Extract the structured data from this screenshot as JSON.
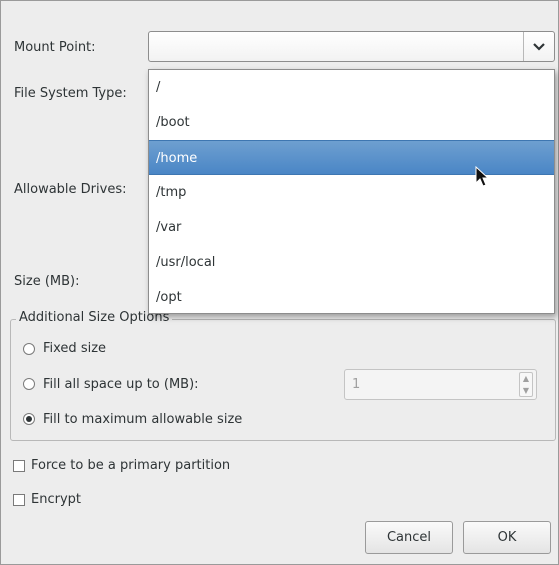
{
  "form": {
    "mount_point_label": "Mount Point:",
    "mount_point_value": "",
    "fs_type_label": "File System Type:",
    "allowable_drives_label": "Allowable Drives:",
    "size_label": "Size (MB):"
  },
  "mount_dropdown": {
    "items": [
      "/",
      "/boot",
      "/home",
      "/tmp",
      "/var",
      "/usr/local",
      "/opt"
    ],
    "selected": "/home"
  },
  "size_options": {
    "title": "Additional Size Options",
    "fixed_label": "Fixed size",
    "fill_upto_label": "Fill all space up to (MB):",
    "fill_upto_value": "1",
    "fill_max_label": "Fill to maximum allowable size",
    "selected": "Fill to maximum allowable size"
  },
  "options": {
    "primary_label": "Force to be a primary partition",
    "primary_checked": false,
    "encrypt_label": "Encrypt",
    "encrypt_checked": false
  },
  "buttons": {
    "cancel": "Cancel",
    "ok": "OK"
  },
  "colors": {
    "selection": "#4a86c6",
    "dialog_bg": "#ededed"
  }
}
